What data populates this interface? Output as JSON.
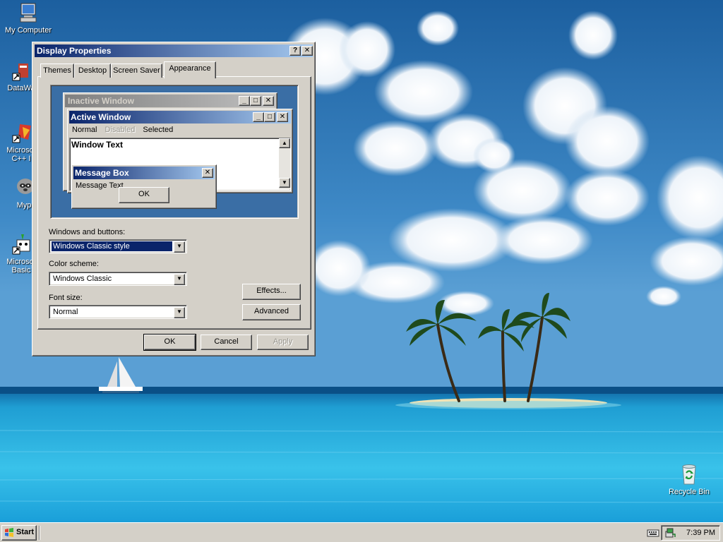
{
  "desktop": {
    "icons": [
      {
        "label": "My Computer"
      },
      {
        "label": "DataWa"
      },
      {
        "label": "Microsof\nC++ I"
      },
      {
        "label": "Myp"
      },
      {
        "label": "Microsof\nBasic"
      },
      {
        "label": "Recycle Bin"
      }
    ]
  },
  "dialog": {
    "title": "Display Properties",
    "help_btn": "?",
    "close_btn": "✕",
    "tabs": [
      {
        "label": "Themes"
      },
      {
        "label": "Desktop"
      },
      {
        "label": "Screen Saver"
      },
      {
        "label": "Appearance"
      }
    ],
    "preview": {
      "inactive_title": "Inactive Window",
      "active_title": "Active Window",
      "menu_normal": "Normal",
      "menu_disabled": "Disabled",
      "menu_selected": "Selected",
      "window_text": "Window Text",
      "msgbox_title": "Message Box",
      "msgbox_text": "Message Text",
      "msgbox_ok": "OK"
    },
    "windows_buttons_label": "Windows and buttons:",
    "windows_buttons_value": "Windows Classic style",
    "color_scheme_label": "Color scheme:",
    "color_scheme_value": "Windows Classic",
    "font_size_label": "Font size:",
    "font_size_value": "Normal",
    "effects_btn": "Effects...",
    "advanced_btn": "Advanced",
    "ok_btn": "OK",
    "cancel_btn": "Cancel",
    "apply_btn": "Apply"
  },
  "taskbar": {
    "start_label": "Start",
    "clock": "7:39 PM"
  },
  "colors": {
    "title_active": "#0a246a",
    "face": "#d4d0c8",
    "desktop_preview": "#3a6ea5"
  }
}
